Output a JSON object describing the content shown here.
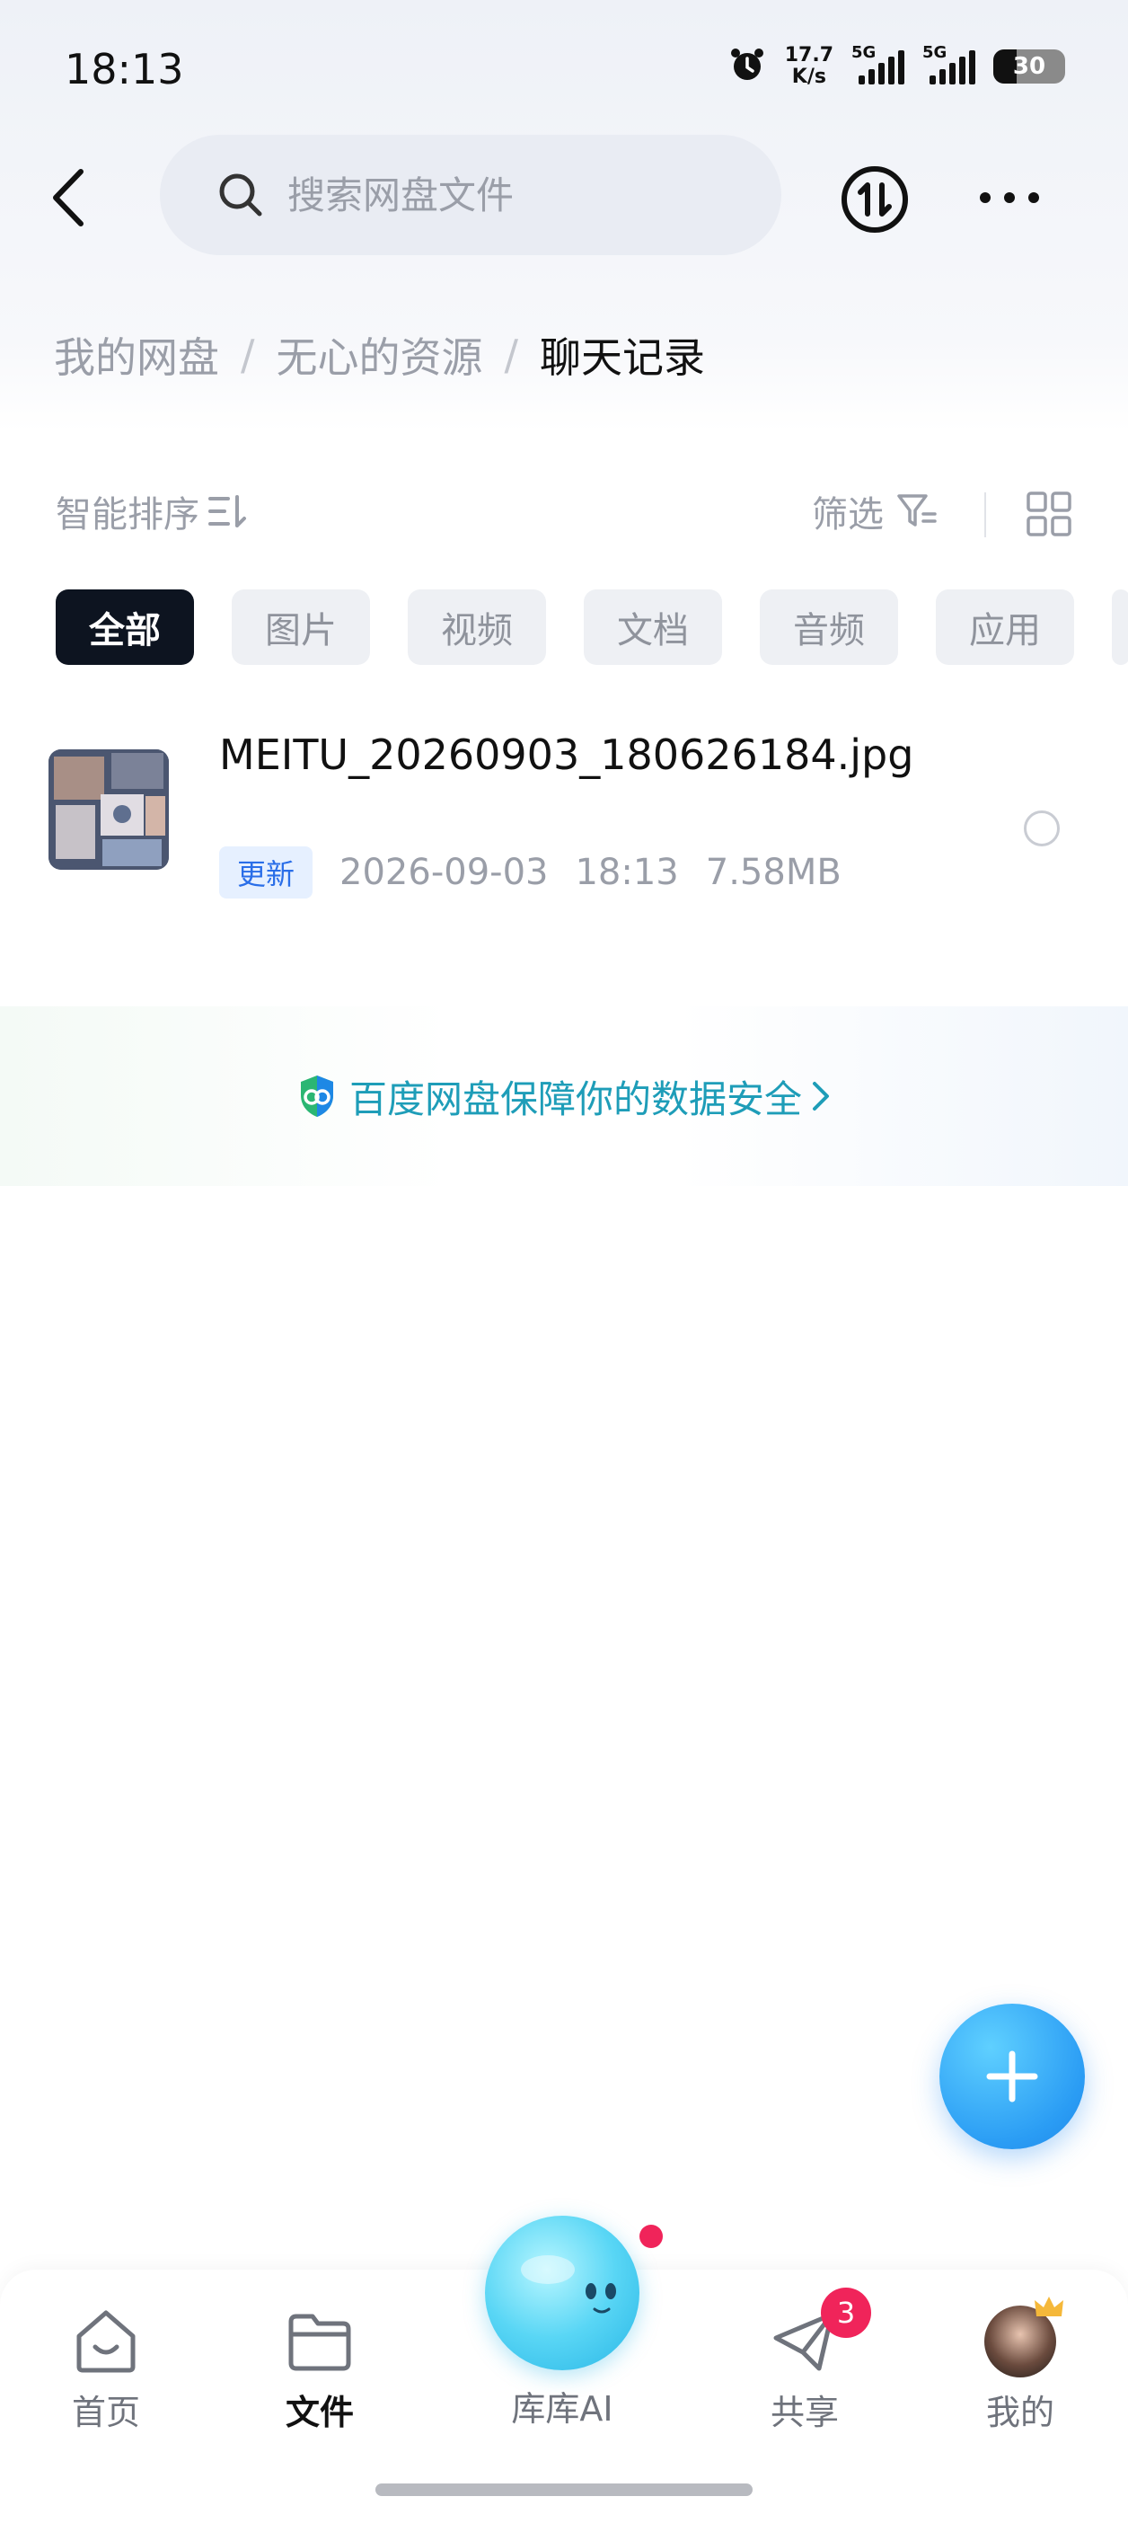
{
  "status_bar": {
    "time": "18:13",
    "network_speed_value": "17.7",
    "network_speed_unit": "K/s",
    "sim1_label": "5G",
    "sim2_label": "5G",
    "battery": "30"
  },
  "header": {
    "search_placeholder": "搜索网盘文件"
  },
  "breadcrumb": {
    "items": [
      "我的网盘",
      "无心的资源",
      "聊天记录"
    ]
  },
  "toolbar": {
    "sort_label": "智能排序",
    "filter_label": "筛选"
  },
  "tabs": [
    {
      "label": "全部",
      "active": true
    },
    {
      "label": "图片",
      "active": false
    },
    {
      "label": "视频",
      "active": false
    },
    {
      "label": "文档",
      "active": false
    },
    {
      "label": "音频",
      "active": false
    },
    {
      "label": "应用",
      "active": false
    }
  ],
  "files": [
    {
      "name": "MEITU_20260903_180626184.jpg",
      "badge": "更新",
      "date": "2026-09-03",
      "time": "18:13",
      "size": "7.58MB"
    }
  ],
  "security_banner": {
    "text": "百度网盘保障你的数据安全"
  },
  "bottom_nav": {
    "items": [
      {
        "label": "首页",
        "icon": "home-icon"
      },
      {
        "label": "文件",
        "icon": "folder-icon",
        "active": true
      },
      {
        "label": "库库AI",
        "icon": "ai-orb-icon"
      },
      {
        "label": "共享",
        "icon": "share-icon",
        "badge": "3"
      },
      {
        "label": "我的",
        "icon": "avatar"
      }
    ]
  },
  "colors": {
    "accent_blue": "#2a9cf4",
    "security_teal": "#1e9db8",
    "badge_red": "#f0245a",
    "active_tab": "#0d1420"
  }
}
